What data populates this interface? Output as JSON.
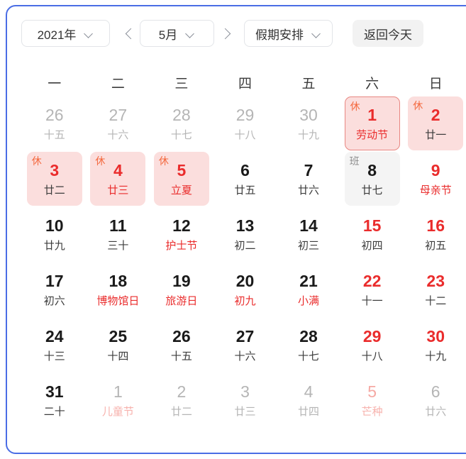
{
  "panel": {
    "accent_border_color": "#4a6de5"
  },
  "toolbar": {
    "year_label": "2021年",
    "prev_icon": "chevron-left-icon",
    "month_label": "5月",
    "next_icon": "chevron-right-icon",
    "holiday_label": "假期安排",
    "today_label": "返回今天",
    "dropdown_icon": "chevron-down-icon"
  },
  "weekdays": [
    "一",
    "二",
    "三",
    "四",
    "五",
    "六",
    "日"
  ],
  "badges": {
    "rest": "休",
    "work": "班"
  },
  "colors": {
    "rest_bg": "#fbdedd",
    "work_bg": "#f4f4f4",
    "today_border": "#e88782",
    "red_text": "#ea2c2c",
    "rest_badge": "#f4693f",
    "work_badge": "#8f8f8f",
    "muted_text": "#b5b5b5"
  },
  "weeks": [
    [
      {
        "num": "26",
        "sub": "十五",
        "outside": true
      },
      {
        "num": "27",
        "sub": "十六",
        "outside": true
      },
      {
        "num": "28",
        "sub": "十七",
        "outside": true
      },
      {
        "num": "29",
        "sub": "十八",
        "outside": true
      },
      {
        "num": "30",
        "sub": "十九",
        "outside": true
      },
      {
        "num": "1",
        "sub": "劳动节",
        "badge": "休",
        "badge_type": "rest",
        "bg": "rest-today",
        "num_red": true,
        "sub_red": true
      },
      {
        "num": "2",
        "sub": "廿一",
        "badge": "休",
        "badge_type": "rest",
        "bg": "rest",
        "num_red": true,
        "sub_red": false
      }
    ],
    [
      {
        "num": "3",
        "sub": "廿二",
        "badge": "休",
        "badge_type": "rest",
        "bg": "rest",
        "num_red": true,
        "sub_red": false
      },
      {
        "num": "4",
        "sub": "廿三",
        "badge": "休",
        "badge_type": "rest",
        "bg": "rest",
        "num_red": true,
        "sub_red": true
      },
      {
        "num": "5",
        "sub": "立夏",
        "badge": "休",
        "badge_type": "rest",
        "bg": "rest",
        "num_red": true,
        "sub_red": true
      },
      {
        "num": "6",
        "sub": "廿五"
      },
      {
        "num": "7",
        "sub": "廿六"
      },
      {
        "num": "8",
        "sub": "廿七",
        "badge": "班",
        "badge_type": "work",
        "bg": "work"
      },
      {
        "num": "9",
        "sub": "母亲节",
        "num_red": true,
        "sub_red": true
      }
    ],
    [
      {
        "num": "10",
        "sub": "廿九"
      },
      {
        "num": "11",
        "sub": "三十"
      },
      {
        "num": "12",
        "sub": "护士节",
        "sub_red": true
      },
      {
        "num": "13",
        "sub": "初二"
      },
      {
        "num": "14",
        "sub": "初三"
      },
      {
        "num": "15",
        "sub": "初四",
        "num_red": true
      },
      {
        "num": "16",
        "sub": "初五",
        "num_red": true
      }
    ],
    [
      {
        "num": "17",
        "sub": "初六"
      },
      {
        "num": "18",
        "sub": "博物馆日",
        "sub_red": true
      },
      {
        "num": "19",
        "sub": "旅游日",
        "sub_red": true
      },
      {
        "num": "20",
        "sub": "初九",
        "sub_red": true
      },
      {
        "num": "21",
        "sub": "小满",
        "sub_red": true
      },
      {
        "num": "22",
        "sub": "十一",
        "num_red": true
      },
      {
        "num": "23",
        "sub": "十二",
        "num_red": true
      }
    ],
    [
      {
        "num": "24",
        "sub": "十三"
      },
      {
        "num": "25",
        "sub": "十四"
      },
      {
        "num": "26",
        "sub": "十五"
      },
      {
        "num": "27",
        "sub": "十六"
      },
      {
        "num": "28",
        "sub": "十七"
      },
      {
        "num": "29",
        "sub": "十八",
        "num_red": true
      },
      {
        "num": "30",
        "sub": "十九",
        "num_red": true
      }
    ],
    [
      {
        "num": "31",
        "sub": "二十"
      },
      {
        "num": "1",
        "sub": "儿童节",
        "outside": true,
        "sub_red": true
      },
      {
        "num": "2",
        "sub": "廿二",
        "outside": true
      },
      {
        "num": "3",
        "sub": "廿三",
        "outside": true
      },
      {
        "num": "4",
        "sub": "廿四",
        "outside": true
      },
      {
        "num": "5",
        "sub": "芒种",
        "outside": true,
        "num_red": true,
        "sub_red": true
      },
      {
        "num": "6",
        "sub": "廿六",
        "outside": true
      }
    ]
  ]
}
